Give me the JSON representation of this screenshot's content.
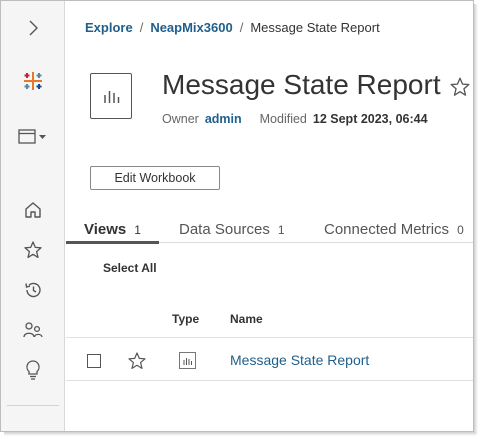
{
  "breadcrumb": {
    "items": [
      "Explore",
      "NeapMix3600"
    ],
    "current": "Message State Report",
    "separator": "/"
  },
  "workbook": {
    "title": "Message State Report",
    "owner_label": "Owner",
    "owner": "admin",
    "modified_label": "Modified",
    "modified": "12 Sept 2023, 06:44",
    "edit_label": "Edit Workbook"
  },
  "tabs": [
    {
      "label": "Views",
      "count": "1",
      "active": true
    },
    {
      "label": "Data Sources",
      "count": "1",
      "active": false
    },
    {
      "label": "Connected Metrics",
      "count": "0",
      "active": false
    }
  ],
  "list": {
    "select_all": "Select All",
    "columns": {
      "type": "Type",
      "name": "Name"
    },
    "rows": [
      {
        "name": "Message State Report",
        "type_icon": "view-chart-icon"
      }
    ]
  },
  "sidebar": {
    "icons": [
      "expand-chevron-icon",
      "tableau-logo-icon",
      "site-menu-icon",
      "home-icon",
      "favorites-icon",
      "recents-icon",
      "shared-with-me-icon",
      "recommendations-icon"
    ]
  },
  "colors": {
    "link": "#1f5f8b",
    "sidebar_bg": "#f5f5f5",
    "text": "#333333"
  }
}
